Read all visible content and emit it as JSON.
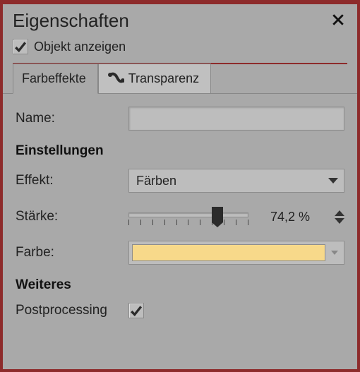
{
  "panel": {
    "title": "Eigenschaften",
    "show_object_label": "Objekt anzeigen",
    "show_object_checked": true
  },
  "tabs": {
    "color_effects": "Farbeffekte",
    "transparency": "Transparenz",
    "active": "color_effects"
  },
  "form": {
    "name_label": "Name:",
    "name_value": "",
    "section_settings": "Einstellungen",
    "effect_label": "Effekt:",
    "effect_value": "Färben",
    "strength_label": "Stärke:",
    "strength_value": "74,2 %",
    "strength_percent": 74.2,
    "color_label": "Farbe:",
    "color_hex": "#f7d98a",
    "section_more": "Weiteres",
    "postprocessing_label": "Postprocessing",
    "postprocessing_checked": true
  }
}
